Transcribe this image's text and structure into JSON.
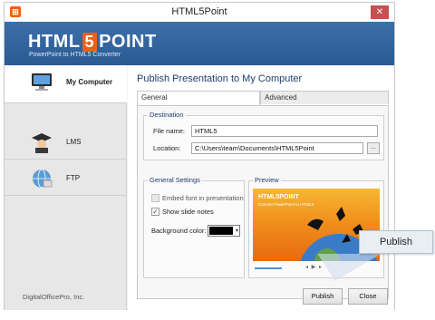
{
  "window": {
    "title": "HTML5Point",
    "close_glyph": "✕"
  },
  "banner": {
    "logo_left": "HTML",
    "logo_5": "5",
    "logo_right": "POINT",
    "tagline": "PowerPoint to HTML5 Converter",
    "colors": {
      "banner": "#2b5a93",
      "accent": "#e8601c"
    }
  },
  "sidebar": {
    "items": [
      {
        "label": "My Computer",
        "icon": "monitor-icon",
        "active": true
      },
      {
        "label": "LMS",
        "icon": "graduate-icon",
        "active": false
      },
      {
        "label": "FTP",
        "icon": "globe-network-icon",
        "active": false
      }
    ]
  },
  "main": {
    "title": "Publish Presentation to My Computer",
    "tabs": [
      {
        "label": "General",
        "active": true
      },
      {
        "label": "Advanced",
        "active": false
      }
    ],
    "destination": {
      "group_title": "Destination",
      "file_name_label": "File name:",
      "file_name_value": "HTML5",
      "location_label": "Location:",
      "location_value": "C:\\Users\\team\\Documents\\HTML5Point",
      "browse_label": "..."
    },
    "general_settings": {
      "group_title": "General Settings",
      "embed_font_label": "Embed font in presentation",
      "embed_font_checked": false,
      "embed_font_enabled": false,
      "show_notes_label": "Show slide notes",
      "show_notes_checked": true,
      "bg_color_label": "Background color:",
      "bg_color_value": "#000000"
    },
    "preview": {
      "group_title": "Preview",
      "slide_title": "HTML5POINT",
      "slide_subtitle": "Convert PowerPoint to HTML5",
      "controls": "◂ ▶ ▸"
    }
  },
  "footer": {
    "company": "DigitalOfficePro, Inc.",
    "publish_label": "Publish",
    "close_label": "Close"
  },
  "callout": {
    "label": "Publish"
  }
}
